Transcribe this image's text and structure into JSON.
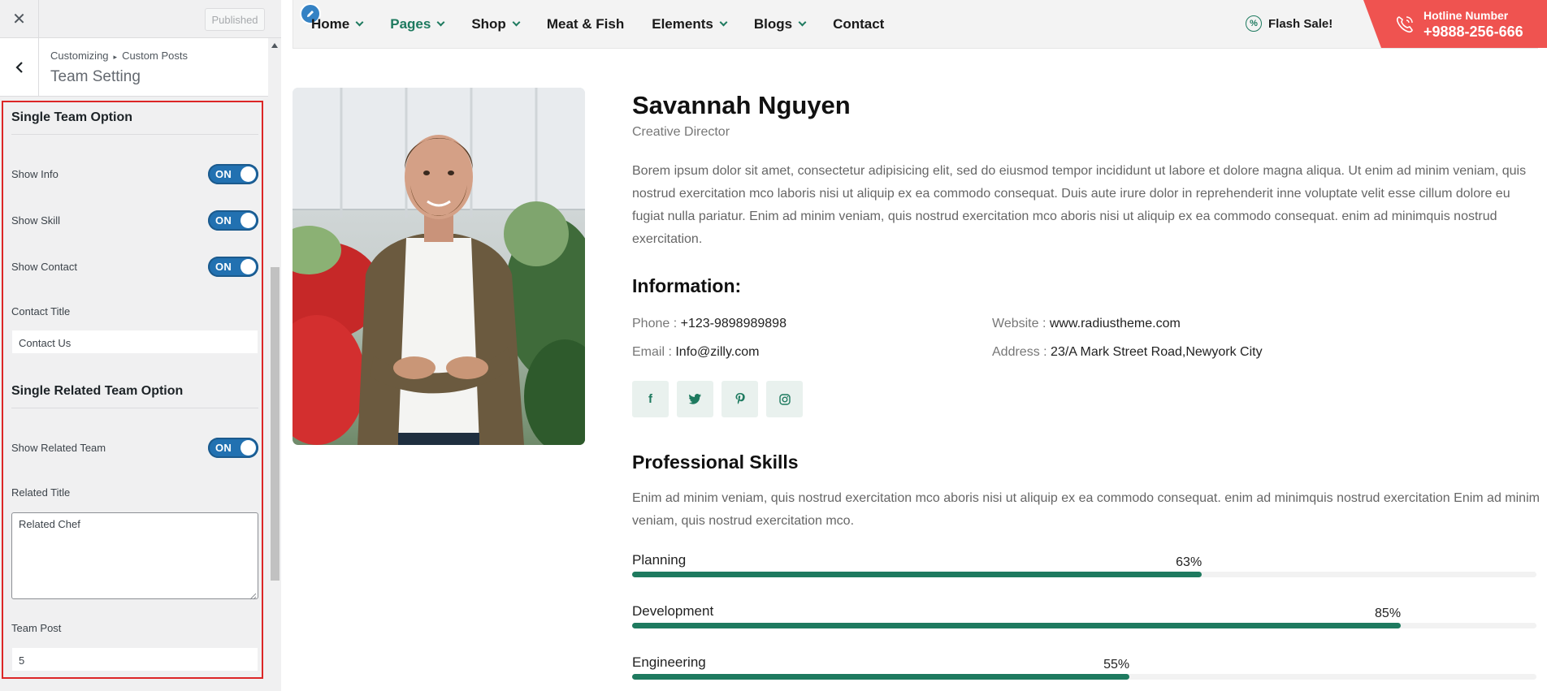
{
  "customizer": {
    "published_label": "Published",
    "breadcrumb": [
      "Customizing",
      "Custom Posts"
    ],
    "title": "Team Setting",
    "single_team": {
      "heading": "Single Team Option",
      "show_info": {
        "label": "Show Info",
        "state": "ON"
      },
      "show_skill": {
        "label": "Show Skill",
        "state": "ON"
      },
      "show_contact": {
        "label": "Show Contact",
        "state": "ON"
      },
      "contact_title": {
        "label": "Contact Title",
        "value": "Contact Us"
      }
    },
    "related_team": {
      "heading": "Single Related Team Option",
      "show_related": {
        "label": "Show Related Team",
        "state": "ON"
      },
      "related_title": {
        "label": "Related Title",
        "value": "Related Chef"
      },
      "team_post": {
        "label": "Team Post",
        "value": "5"
      }
    }
  },
  "nav": {
    "items": [
      {
        "label": "Home",
        "dropdown": true,
        "active": false
      },
      {
        "label": "Pages",
        "dropdown": true,
        "active": true
      },
      {
        "label": "Shop",
        "dropdown": true,
        "active": false
      },
      {
        "label": "Meat & Fish",
        "dropdown": false,
        "active": false
      },
      {
        "label": "Elements",
        "dropdown": true,
        "active": false
      },
      {
        "label": "Blogs",
        "dropdown": true,
        "active": false
      },
      {
        "label": "Contact",
        "dropdown": false,
        "active": false
      }
    ],
    "flash_sale": "Flash Sale!",
    "hotline_label": "Hotline Number",
    "hotline_number": "+9888-256-666"
  },
  "member": {
    "name": "Savannah Nguyen",
    "role": "Creative Director",
    "bio": "Borem ipsum dolor sit amet, consectetur adipisicing elit, sed do eiusmod tempor incididunt ut labore et dolore magna aliqua. Ut enim ad minim veniam, quis nostrud exercitation mco laboris nisi ut aliquip ex ea commodo consequat. Duis aute irure dolor in reprehenderit inne voluptate velit esse cillum dolore eu fugiat nulla pariatur. Enim ad minim veniam, quis nostrud exercitation mco aboris nisi ut aliquip ex ea commodo consequat. enim ad minimquis nostrud exercitation.",
    "info_heading": "Information:",
    "info": {
      "phone_label": "Phone :",
      "phone": "+123-9898989898",
      "email_label": "Email :",
      "email": "Info@zilly.com",
      "website_label": "Website :",
      "website": "www.radiustheme.com",
      "address_label": "Address :",
      "address": "23/A Mark Street Road,Newyork City"
    },
    "social_icons": [
      "facebook-icon",
      "twitter-icon",
      "pinterest-icon",
      "instagram-icon"
    ],
    "skills_heading": "Professional Skills",
    "skills_text": "Enim ad minim veniam, quis nostrud exercitation mco aboris nisi ut aliquip ex ea commodo consequat. enim ad minimquis nostrud exercitation Enim ad minim veniam, quis nostrud exercitation mco.",
    "skills": [
      {
        "label": "Planning",
        "percent": 63,
        "percent_text": "63%"
      },
      {
        "label": "Development",
        "percent": 85,
        "percent_text": "85%"
      },
      {
        "label": "Engineering",
        "percent": 55,
        "percent_text": "55%"
      }
    ]
  },
  "colors": {
    "accent": "#1e7a5f",
    "hotline": "#ef5350",
    "toggle": "#2271b1",
    "highlight": "#dc2626"
  }
}
